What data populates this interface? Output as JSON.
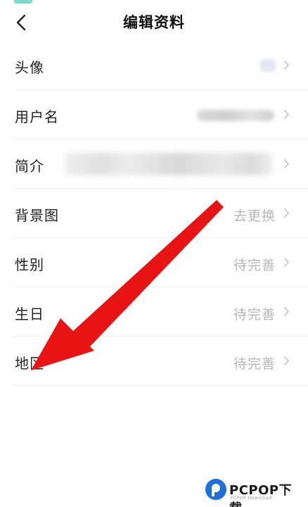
{
  "header": {
    "title": "编辑资料"
  },
  "profile": {
    "rows": [
      {
        "label": "头像",
        "value": ""
      },
      {
        "label": "用户名",
        "value": ""
      },
      {
        "label": "简介",
        "value": ""
      },
      {
        "label": "背景图",
        "value": "去更换"
      },
      {
        "label": "性别",
        "value": "待完善"
      },
      {
        "label": "生日",
        "value": "待完善"
      },
      {
        "label": "地区",
        "value": "待完善"
      }
    ]
  },
  "annotation": {
    "arrow_color": "#e81414"
  },
  "watermark": {
    "brand": "PCPOP下载",
    "sub": "PCPOP Download"
  },
  "colors": {
    "accent": "#7fd8c8",
    "value_gray": "#b6b6b6",
    "brand_blue": "#1e6fd8"
  }
}
